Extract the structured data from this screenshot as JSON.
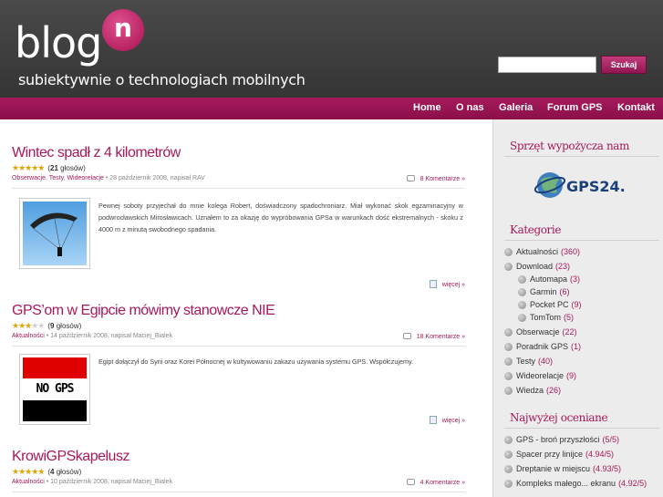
{
  "header": {
    "logo_text": "blog",
    "logo_letter": "n",
    "tagline": "subiektywnie o technologiach mobilnych",
    "search_placeholder": "",
    "search_button": "Szukaj"
  },
  "nav": {
    "items": [
      "Home",
      "O nas",
      "Galeria",
      "Forum GPS",
      "Kontakt"
    ]
  },
  "posts": [
    {
      "title": "Wintec spadł z 4 kilometrów",
      "rating_count": "21",
      "rating_suffix": "głosów",
      "stars": 5,
      "categories": [
        "Obserwacje",
        "Testy",
        "Wideorelacje"
      ],
      "meta": "28 październik 2008, napisał RAV",
      "comments": "8 Komentarze »",
      "excerpt": "Pewnej soboty przyjechał do mnie kolega Robert, doświadczony spadochroniarz. Miał wykonać skok egzaminacyjny w podwrocławskich Mirosławicach. Uznałem to za okazję do wypróbowania GPSa w warunkach dość ekstremalnych - skoku z 4000 m z minutą swobodnego spadania.",
      "more": "więcej »"
    },
    {
      "title": "GPS’om w Egipcie mówimy stanowcze NIE",
      "rating_count": "9",
      "rating_suffix": "głosów",
      "stars": 3,
      "categories": [
        "Aktualności"
      ],
      "meta": "14 październik 2008, napisał Maciej_Bialek",
      "comments": "18 Komentarze »",
      "excerpt": "Egipt dołączył do Syrii oraz Korei Północnej w kultywowaniu zakazu używania systemu GPS. Współczujemy.",
      "thumb_text": "NO GPS",
      "more": "więcej »"
    },
    {
      "title": "KrowiGPSkapelusz",
      "rating_count": "4",
      "rating_suffix": "głosów",
      "stars": 5,
      "categories": [
        "Aktualności"
      ],
      "meta": "10 październik 2008, napisał Maciej_Bialek",
      "comments": "4 Komentarze »"
    }
  ],
  "sidebar": {
    "sponsor_title": "Sprzęt wypożycza nam",
    "sponsor_logo": "GPS24.pl",
    "categories_title": "Kategorie",
    "categories": [
      {
        "label": "Aktualności",
        "count": "(360)"
      },
      {
        "label": "Download",
        "count": "(23)"
      },
      {
        "label": "Automapa",
        "count": "(3)"
      },
      {
        "label": "Garmin",
        "count": "(6)"
      },
      {
        "label": "Pocket PC",
        "count": "(9)"
      },
      {
        "label": "TomTom",
        "count": "(5)"
      },
      {
        "label": "Obserwacje",
        "count": "(22)"
      },
      {
        "label": "Poradnik GPS",
        "count": "(1)"
      },
      {
        "label": "Testy",
        "count": "(40)"
      },
      {
        "label": "Wideorelacje",
        "count": "(9)"
      },
      {
        "label": "Wiedza",
        "count": "(26)"
      }
    ],
    "top_rated_title": "Najwyżej oceniane",
    "top_rated": [
      {
        "label": "GPS - broń przyszłości",
        "score": "(5/5)"
      },
      {
        "label": "Spacer przy linijce",
        "score": "(4.94/5)"
      },
      {
        "label": "Dreptanie w miejscu",
        "score": "(4.93/5)"
      },
      {
        "label": "Kompleks małego... ekranu",
        "score": "(4.92/5)"
      }
    ]
  },
  "colors": {
    "accent": "#a8185a",
    "header_bg": "#404040",
    "nav_bg": "#9b1554",
    "sidebar_bg": "#ececec"
  }
}
